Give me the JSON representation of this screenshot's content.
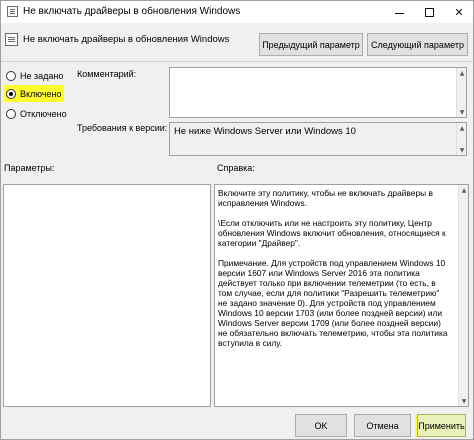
{
  "window": {
    "title": "Не включать драйверы в обновления Windows"
  },
  "header": {
    "policy_name": "Не включать драйверы в обновления Windows",
    "prev_button": "Предыдущий параметр",
    "next_button": "Следующий параметр"
  },
  "state": {
    "options": [
      {
        "label": "Не задано",
        "checked": false
      },
      {
        "label": "Включено",
        "checked": true
      },
      {
        "label": "Отключено",
        "checked": false
      }
    ]
  },
  "comment": {
    "label": "Комментарий:",
    "value": ""
  },
  "requirements": {
    "label": "Требования к версии:",
    "value": "Не ниже Windows Server или Windows 10"
  },
  "params": {
    "label": "Параметры:"
  },
  "help": {
    "label": "Справка:",
    "paragraphs": [
      "Включите эту политику, чтобы не включать драйверы в исправления Windows.",
      "\\Если отключить или не настроить эту политику, Центр обновления Windows включит обновления, относящиеся к категории \"Драйвер\".",
      "Примечание. Для устройств под управлением Windows 10 версии 1607 или Windows Server 2016 эта политика действует только при включении телеметрии (то есть, в том случае, если для политики \"Разрешить телеметрию\" не задано значение 0). Для устройств под управлением Windows 10 версии 1703 (или более поздней версии) или Windows Server версии 1709 (или более поздней версии) не обязательно включать телеметрию, чтобы эта политика вступила в силу."
    ]
  },
  "footer": {
    "ok": "OK",
    "cancel": "Отмена",
    "apply": "Применить"
  },
  "colors": {
    "highlight": "#ffff2e",
    "window_bg": "#f0f0f0",
    "button_bg": "#e1e1e1"
  }
}
